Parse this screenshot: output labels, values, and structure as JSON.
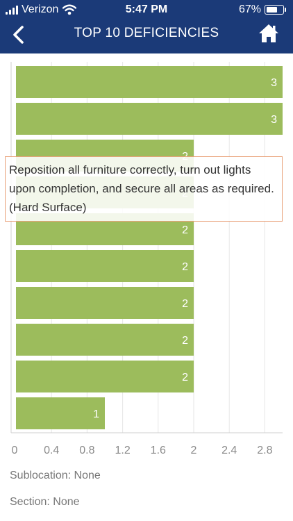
{
  "status_bar": {
    "carrier": "Verizon",
    "time": "5:47 PM",
    "battery": "67%",
    "battery_level": 0.67
  },
  "nav": {
    "title": "TOP 10 DEFICIENCIES",
    "back_icon": "chevron-left-icon",
    "home_icon": "home-icon"
  },
  "colors": {
    "header": "#1b3a78",
    "bar": "#9cbc5c",
    "tooltip_border": "#e9a27a"
  },
  "chart_data": {
    "type": "bar",
    "orientation": "horizontal",
    "values": [
      3,
      3,
      2,
      2,
      2,
      2,
      2,
      2,
      2,
      1
    ],
    "data_labels": [
      "3",
      "3",
      "2",
      "2",
      "2",
      "2",
      "2",
      "2",
      "2",
      "1"
    ],
    "xlim": [
      0,
      3
    ],
    "xticks": [
      0,
      0.4,
      0.8,
      1.2,
      1.6,
      2,
      2.4,
      2.8
    ],
    "xtick_labels": [
      "0",
      "0.4",
      "0.8",
      "1.2",
      "1.6",
      "2",
      "2.4",
      "2.8"
    ],
    "grid": true,
    "tooltip": "Reposition all furniture correctly, turn out lights upon completion, and secure all areas as required. (Hard Surface)"
  },
  "footer": {
    "sublocation": "Sublocation: None",
    "section": "Section: None"
  }
}
